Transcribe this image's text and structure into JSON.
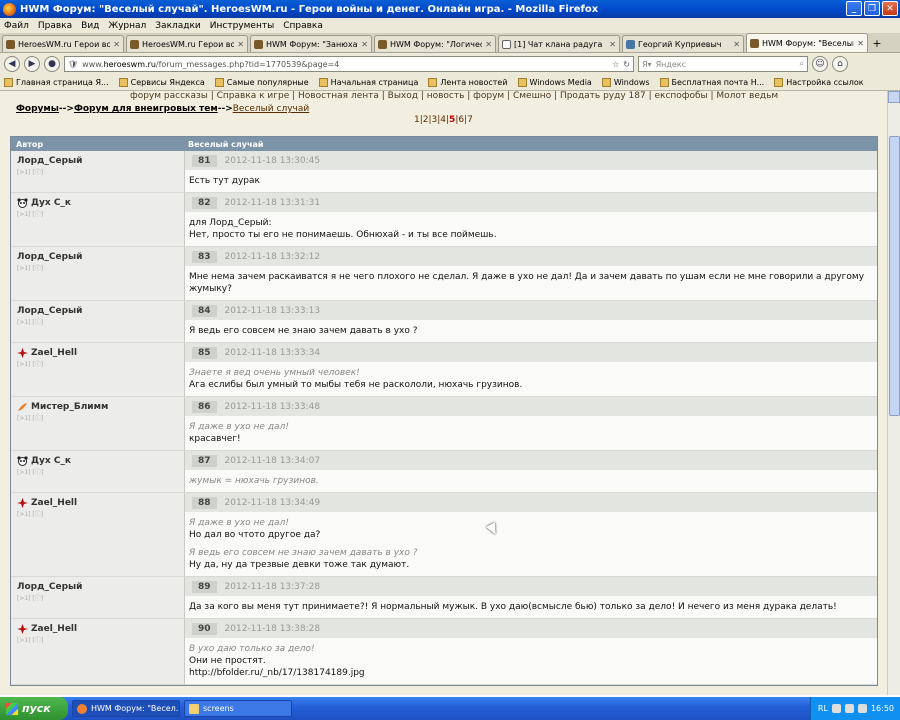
{
  "window": {
    "title": "HWM Форум: \"Веселый случай\". HeroesWM.ru - Герои войны и денег. Онлайн игра. - Mozilla Firefox"
  },
  "menu": [
    "Файл",
    "Правка",
    "Вид",
    "Журнал",
    "Закладки",
    "Инструменты",
    "Справка"
  ],
  "tabs": [
    {
      "label": "HeroesWM.ru Герои войн...",
      "icon": "hwm-icon"
    },
    {
      "label": "HeroesWM.ru Герои войн...",
      "icon": "hwm-icon"
    },
    {
      "label": "HWM Форум: \"Занюхать\"...",
      "icon": "hwm-icon"
    },
    {
      "label": "HWM Форум: \"Логическо...",
      "icon": "hwm-icon"
    },
    {
      "label": "[1] Чат клана радуга",
      "icon": "page-icon"
    },
    {
      "label": "Георгий Куприевыч",
      "icon": "vk-icon"
    },
    {
      "label": "HWM Форум: \"Веселый с...",
      "icon": "hwm-icon",
      "active": true
    }
  ],
  "url": {
    "prefix": "www.",
    "domain": "heroeswm.ru",
    "path": "/forum_messages.php?tid=1770539&page=4"
  },
  "search": {
    "placeholder": "Яндекс"
  },
  "bookmarks": [
    "Главная страница Я...",
    "Сервисы Яндекса",
    "Самые популярные",
    "Начальная страница",
    "Лента новостей",
    "Windows Media",
    "Windows",
    "Бесплатная почта H...",
    "Настройка ссылок"
  ],
  "toplinks": "форум рассказы | Справка к игре | Новостная лента | Выход | новость | форум | Смешно | Продать руду 187 | експофобы | Молот ведьм",
  "breadcrumb": {
    "forums": "Форумы",
    "sep1": "-->",
    "section": "Форум для внеигровых тем",
    "sep2": "-->",
    "topic": "Веселый случай"
  },
  "pagination": {
    "before": "1|2|3|4|",
    "current": "5",
    "after": "|6|7"
  },
  "table": {
    "col_author": "Автор",
    "col_topic": "Веселый случай"
  },
  "posts": [
    {
      "author": "Лорд_Серый",
      "meta": "[>1] [ⓘ]",
      "badge": "",
      "num": "81",
      "date": "2012-11-18 13:30:45",
      "quotes": [],
      "text": "Есть тут дурак"
    },
    {
      "author": "Дух С_к",
      "meta": "[>1] [ⓘ]",
      "badge": "panda",
      "num": "82",
      "date": "2012-11-18 13:31:31",
      "quotes": [],
      "text": "для Лорд_Серый:\nНет, просто ты его не понимаешь. Обнюхай - и ты все поймешь."
    },
    {
      "author": "Лорд_Серый",
      "meta": "[>1] [ⓘ]",
      "badge": "",
      "num": "83",
      "date": "2012-11-18 13:32:12",
      "quotes": [],
      "text": "Мне нема зачем раскаиватся я не чего плохого не сделал. Я даже в ухо не дал! Да и зачем давать по ушам если не мне говорили а другому жумыку?"
    },
    {
      "author": "Лорд_Серый",
      "meta": "[>1] [ⓘ]",
      "badge": "",
      "num": "84",
      "date": "2012-11-18 13:33:13",
      "quotes": [],
      "text": "Я ведь его совсем не знаю зачем давать в ухо ?"
    },
    {
      "author": "Zael_Hell",
      "meta": "[>1] [ⓘ]",
      "badge": "cross",
      "num": "85",
      "date": "2012-11-18 13:33:34",
      "quotes": [
        "Знаете я вед очень умный человек!"
      ],
      "text": "Ага еслибы был умный то мыбы тебя не раскололи, нюхачь грузинов."
    },
    {
      "author": "Мистер_Блимм",
      "meta": "[>1] [ⓘ]",
      "badge": "feather",
      "num": "86",
      "date": "2012-11-18 13:33:48",
      "quotes": [
        "Я даже в ухо не дал!"
      ],
      "text": "красавчег!"
    },
    {
      "author": "Дух С_к",
      "meta": "[>1] [ⓘ]",
      "badge": "panda",
      "num": "87",
      "date": "2012-11-18 13:34:07",
      "quotes": [
        "жумык = нюхачь грузинов."
      ],
      "text": ""
    },
    {
      "author": "Zael_Hell",
      "meta": "[>1] [ⓘ]",
      "badge": "cross",
      "num": "88",
      "date": "2012-11-18 13:34:49",
      "quotes": [
        "Я даже в ухо не дал!"
      ],
      "text": "Но дал во чтото другое да?",
      "quote2": "Я ведь его совсем не знаю зачем давать в ухо ?",
      "text2": "Ну да, ну да трезвые девки тоже так думают."
    },
    {
      "author": "Лорд_Серый",
      "meta": "[>1] [ⓘ]",
      "badge": "",
      "num": "89",
      "date": "2012-11-18 13:37:28",
      "quotes": [],
      "text": "Да за кого вы меня тут принимаете?! Я нормальный мужык. В ухо даю(всмысле бью) только за дело! И нечего из меня дурака делать!"
    },
    {
      "author": "Zael_Hell",
      "meta": "[>1] [ⓘ]",
      "badge": "cross",
      "num": "90",
      "date": "2012-11-18 13:38:28",
      "quotes": [
        "В ухо даю только за дело!"
      ],
      "text": "Они не простят.\nhttp://bfolder.ru/_nb/17/138174189.jpg"
    }
  ],
  "taskbar": {
    "start": "пуск",
    "tasks": [
      "HWM Форум: \"Весел...",
      "screens"
    ],
    "lang": "RL",
    "time": "16:50"
  },
  "colors": {
    "header": "#7d93a8",
    "author_bg": "#ecedeb",
    "page_bg": "#f2efe0",
    "date": "#999999"
  }
}
